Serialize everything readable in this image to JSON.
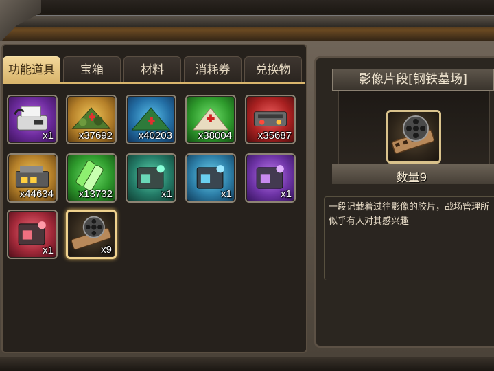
{
  "tabs": [
    {
      "label": "功能道具",
      "active": true
    },
    {
      "label": "宝箱",
      "active": false
    },
    {
      "label": "材料",
      "active": false
    },
    {
      "label": "消耗券",
      "active": false
    },
    {
      "label": "兑换物",
      "active": false
    }
  ],
  "items": [
    {
      "icon": "fax-machine-icon",
      "count": "x1",
      "bg": "purple"
    },
    {
      "icon": "camo-medical-tent-icon",
      "count": "x37692",
      "bg": "gold"
    },
    {
      "icon": "green-medical-tent-icon",
      "count": "x40203",
      "bg": "blue"
    },
    {
      "icon": "white-medical-tent-icon",
      "count": "x38004",
      "bg": "green"
    },
    {
      "icon": "machine-part-icon",
      "count": "x35687",
      "bg": "red"
    },
    {
      "icon": "ammo-crate-icon",
      "count": "x44634",
      "bg": "gold"
    },
    {
      "icon": "energy-canister-icon",
      "count": "x13732",
      "bg": "green"
    },
    {
      "icon": "teal-module-box-icon",
      "count": "x1",
      "bg": "teal"
    },
    {
      "icon": "cyan-module-box-icon",
      "count": "x1",
      "bg": "cyan"
    },
    {
      "icon": "violet-module-box-icon",
      "count": "x1",
      "bg": "violet"
    },
    {
      "icon": "red-module-box-icon",
      "count": "x1",
      "bg": "crimson"
    },
    {
      "icon": "film-reel-icon",
      "count": "x9",
      "bg": "dark",
      "selected": true
    }
  ],
  "detail": {
    "title": "影像片段[钢铁墓场]",
    "quantity": "数量9",
    "description": "一段记载着过往影像的胶片，战场管理所似乎有人对其感兴趣",
    "icon": "film-reel-icon"
  }
}
